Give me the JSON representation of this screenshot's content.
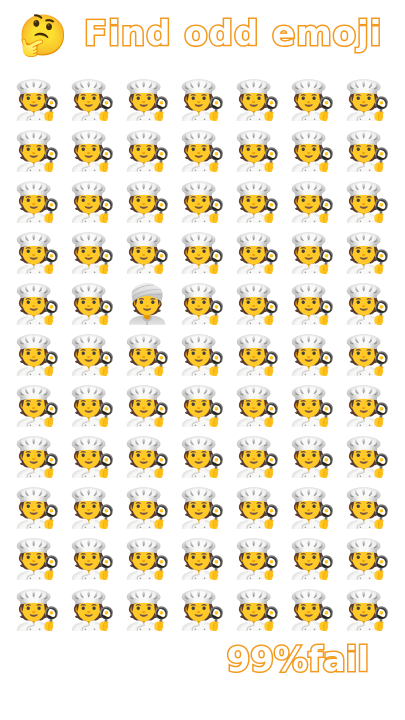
{
  "header": {
    "icon": "🤔",
    "title": "Find odd emoji"
  },
  "puzzle": {
    "rows": 11,
    "cols": 7,
    "base_emoji": "🧑‍🍳",
    "odd_emoji": "👳",
    "odd_position": {
      "row": 5,
      "col": 3
    }
  },
  "footer": {
    "caption": "99%fail"
  },
  "colors": {
    "accent": "#f39a1f",
    "background": "#ffffff"
  }
}
